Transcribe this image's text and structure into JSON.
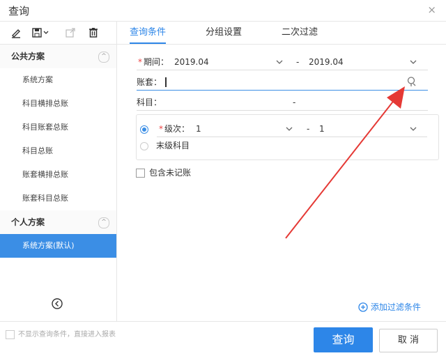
{
  "window": {
    "title": "查询",
    "close_glyph": "×"
  },
  "toolbar": {
    "icons": [
      "edit-icon",
      "save-icon",
      "export-icon",
      "delete-icon"
    ]
  },
  "sidebar": {
    "public_group": {
      "label": "公共方案",
      "toggle": "^"
    },
    "public_items": [
      "系统方案",
      "科目横排总账",
      "科目账套总账",
      "科目总账",
      "账套横排总账",
      "账套科目总账"
    ],
    "personal_group": {
      "label": "个人方案",
      "toggle": "^"
    },
    "personal_items": [
      "系统方案(默认)"
    ]
  },
  "tabs": [
    "查询条件",
    "分组设置",
    "二次过滤"
  ],
  "form": {
    "period": {
      "label": "期间：",
      "from": "2019.04",
      "sep": "-",
      "to": "2019.04"
    },
    "account_set": {
      "label": "账套：",
      "value": ""
    },
    "subject": {
      "label": "科目：",
      "sep": "-"
    },
    "level": {
      "label": "级次：",
      "from": "1",
      "sep": "-",
      "to": "1"
    },
    "leaf_subject": {
      "label": "末级科目"
    },
    "include_unposted": {
      "label": "包含未记账",
      "checked": false
    }
  },
  "add_filter": {
    "label": "添加过滤条件",
    "icon": "plus-circle-icon"
  },
  "footer": {
    "skip_dialog": {
      "label": "不显示查询条件，直接进入报表",
      "checked": false
    },
    "confirm_label": "查询",
    "cancel_label": "取 消"
  },
  "colors": {
    "accent": "#2d86e8",
    "annotation_arrow": "#e53935",
    "required": "#e44444"
  }
}
